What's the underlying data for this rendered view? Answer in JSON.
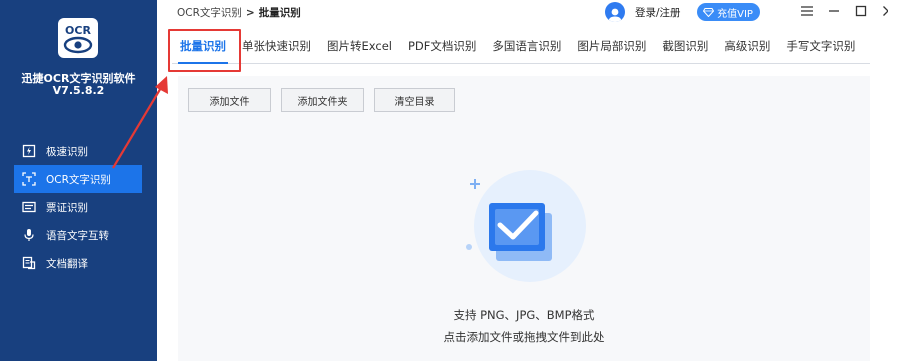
{
  "app": {
    "logo_text": "OCR",
    "name": "迅捷OCR文字识别软件",
    "version": "V7.5.8.2"
  },
  "sidebar": {
    "items": [
      {
        "label": "极速识别",
        "icon": "lightning-doc-icon",
        "active": false
      },
      {
        "label": "OCR文字识别",
        "icon": "scan-frame-icon",
        "active": true
      },
      {
        "label": "票证识别",
        "icon": "ticket-icon",
        "active": false
      },
      {
        "label": "语音文字互转",
        "icon": "microphone-icon",
        "active": false
      },
      {
        "label": "文档翻译",
        "icon": "translate-icon",
        "active": false
      }
    ]
  },
  "breadcrumb": {
    "root": "OCR文字识别",
    "separator": ">",
    "current": "批量识别"
  },
  "header": {
    "login_label": "登录/注册",
    "vip_label": "充值VIP",
    "vip_color": "#3a8cf7"
  },
  "tabs": [
    {
      "label": "批量识别",
      "active": true
    },
    {
      "label": "单张快速识别",
      "active": false
    },
    {
      "label": "图片转Excel",
      "active": false
    },
    {
      "label": "PDF文档识别",
      "active": false
    },
    {
      "label": "多国语言识别",
      "active": false
    },
    {
      "label": "图片局部识别",
      "active": false
    },
    {
      "label": "截图识别",
      "active": false
    },
    {
      "label": "高级识别",
      "active": false
    },
    {
      "label": "手写文字识别",
      "active": false
    }
  ],
  "toolbar": {
    "add_file": "添加文件",
    "add_folder": "添加文件夹",
    "clear_list": "清空目录"
  },
  "dropzone": {
    "line1": "支持 PNG、JPG、BMP格式",
    "line2": "点击添加文件或拖拽文件到此处"
  },
  "colors": {
    "sidebar_bg": "#18407f",
    "accent": "#1c74e9",
    "annotation": "#e53935"
  }
}
